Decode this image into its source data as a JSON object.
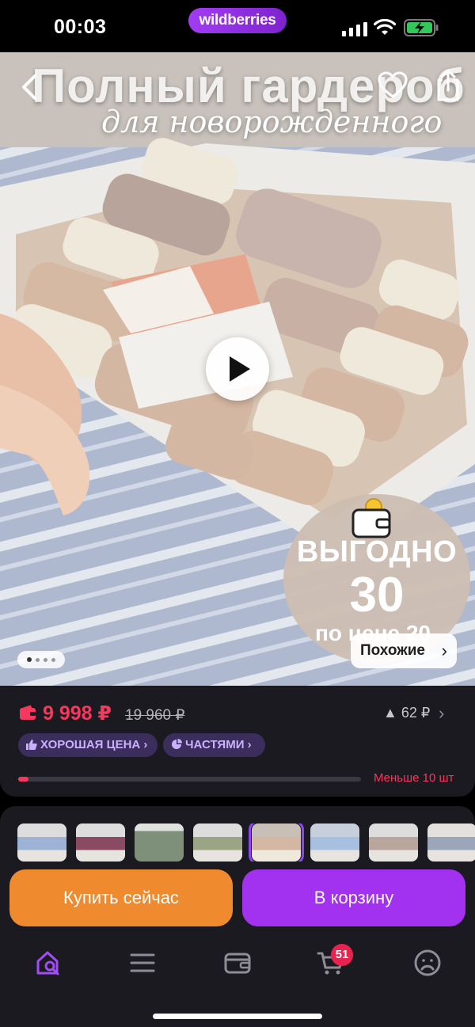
{
  "status_bar": {
    "time": "00:03",
    "brand": "wildberries",
    "icons": [
      "signal-icon",
      "wifi-icon",
      "battery-charging-icon"
    ]
  },
  "product_media": {
    "headline": "Полный гардероб",
    "subheadline": "для новорожденного",
    "promo": {
      "line1": "ВЫГОДНО",
      "line2": "30",
      "line3": "по цене 20"
    },
    "similar_label": "Похожие",
    "icons": [
      "back-icon",
      "heart-icon",
      "share-icon",
      "play-icon"
    ],
    "page_count": 4,
    "active_page": 1
  },
  "price": {
    "current": "9 998 ₽",
    "old": "19 960 ₽",
    "delta": "62 ₽",
    "chips": {
      "good_price": "ХОРОШАЯ ЦЕНА",
      "installments": "ЧАСТЯМИ"
    },
    "stock_text": "Меньше 10 шт",
    "stock_level": 0.03
  },
  "actions": {
    "buy_now": "Купить сейчас",
    "add_to_cart": "В корзину"
  },
  "tabbar": {
    "items": [
      "home-search-icon",
      "catalog-icon",
      "wallet-icon",
      "cart-icon",
      "profile-icon"
    ],
    "cart_badge": "51"
  },
  "colors": {
    "accent_purple": "#a331f0",
    "buy_orange": "#f08a2e",
    "price_red": "#f5385e",
    "panel_bg": "#1c1a21"
  }
}
